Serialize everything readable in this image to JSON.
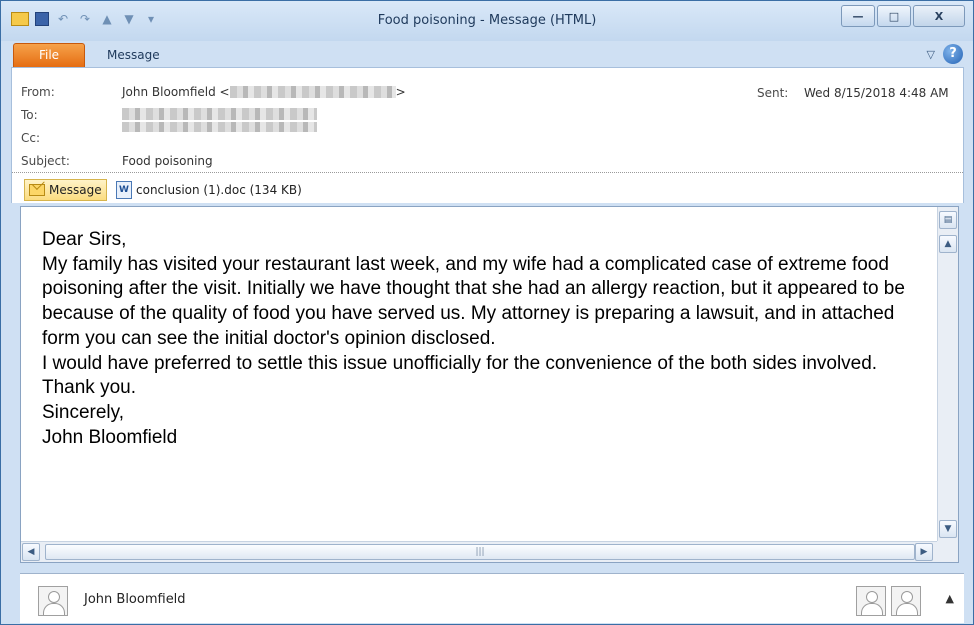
{
  "window": {
    "title": "Food poisoning  -  Message (HTML)",
    "controls": {
      "minimize": "—",
      "maximize": "□",
      "close": "X"
    }
  },
  "ribbon": {
    "tabs": [
      "File",
      "Message"
    ],
    "collapse_icon": "ribbon-collapse-icon",
    "help_icon": "?"
  },
  "header": {
    "from_label": "From:",
    "from_name": "John Bloomfield <",
    "from_suffix": ">",
    "to_label": "To:",
    "cc_label": "Cc:",
    "subject_label": "Subject:",
    "subject_value": "Food poisoning",
    "sent_label": "Sent:",
    "sent_value": "Wed 8/15/2018 4:48 AM"
  },
  "attachments": {
    "message_tab": "Message",
    "file_name": "conclusion (1).doc (134 KB)"
  },
  "body": {
    "paragraphs": [
      "Dear Sirs,",
      "My family has visited your restaurant last week, and my wife had a complicated case of extreme food poisoning after the visit. Initially we have thought that she had an allergy reaction, but it appeared to be because of the quality of food you have served us. My attorney is preparing a lawsuit, and in attached form you can see the initial doctor's opinion disclosed.",
      "I would have preferred to settle this issue unofficially for the convenience of the both sides involved.",
      "Thank you.",
      "Sincerely,",
      "John Bloomfield"
    ]
  },
  "people_pane": {
    "contact_name": "John Bloomfield",
    "collapse_glyph": "▲"
  }
}
